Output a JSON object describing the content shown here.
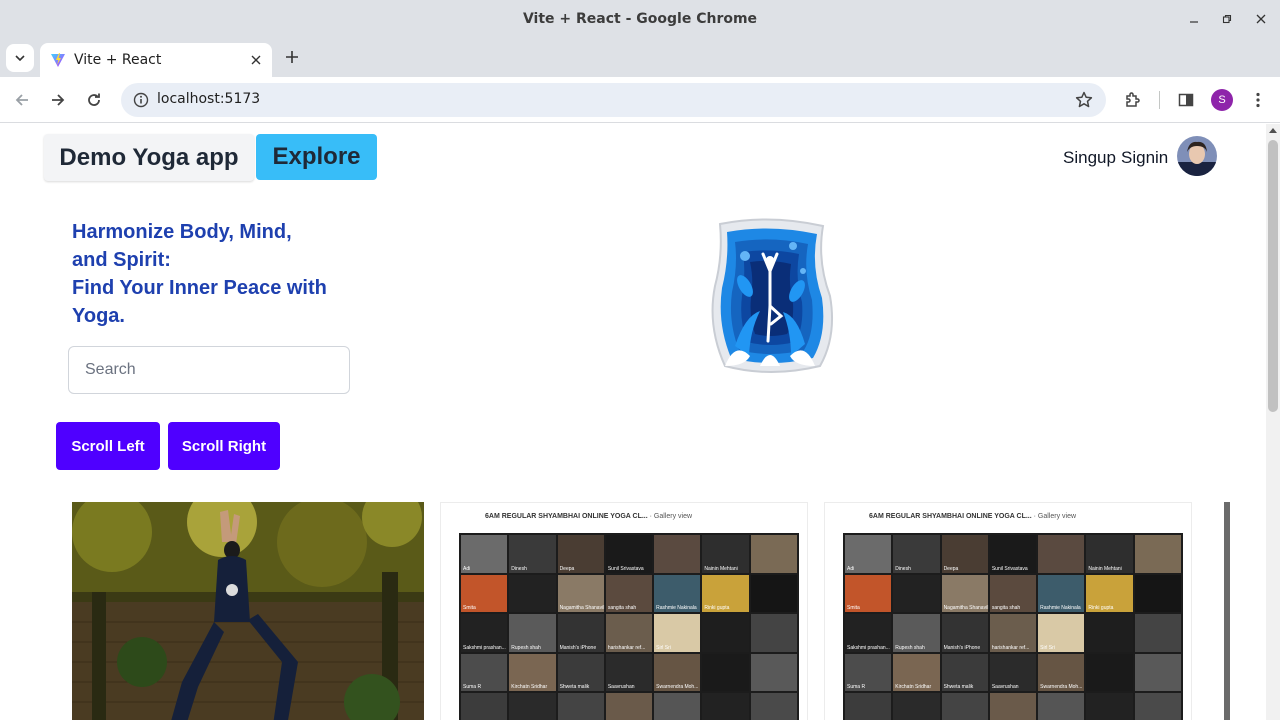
{
  "window": {
    "title": "Vite + React - Google Chrome"
  },
  "tab": {
    "title": "Vite + React"
  },
  "address_bar": {
    "url": "localhost:5173"
  },
  "profile": {
    "initial": "S"
  },
  "nav": {
    "brand": "Demo Yoga app",
    "explore": "Explore",
    "signup": "Singup",
    "signin": "Signin"
  },
  "hero": {
    "headline_line1": "Harmonize Body, Mind,",
    "headline_line2": "and Spirit:",
    "headline_line3": "Find Your Inner Peace with",
    "headline_line4": "Yoga."
  },
  "search": {
    "placeholder": "Search"
  },
  "buttons": {
    "scroll_left": "Scroll Left",
    "scroll_right": "Scroll Right"
  },
  "gallery": {
    "title": "6AM REGULAR SHYAMBHAI ONLINE YOGA CL...",
    "view": "· Gallery view",
    "participants": [
      "Adi",
      "Dinesh",
      "Deepa",
      "Sunil Srivastava",
      "",
      "Nainin Mehtani",
      "",
      "Smita",
      "",
      "Nagamitha Shanavil",
      "sangita shah",
      "Rashmie Nakinala",
      "Rinki gupta",
      "",
      "Sakshmi prashan...",
      "Rupesh shah",
      "Manish's iPhone",
      "harishankar ref...",
      "Sirl Sri",
      "",
      "",
      "Suma R",
      "Kirchatn Sridhar",
      "Shweta malik",
      "Saavrushan",
      "Swarnendra Moh...",
      "",
      "",
      "",
      "",
      "",
      "",
      "",
      "",
      ""
    ],
    "colors": [
      "#6b6b6b",
      "#3a3a3a",
      "#4a3d33",
      "#1a1a1a",
      "#5a4a40",
      "#2e2e2e",
      "#7a6a55",
      "#c2552a",
      "#222",
      "#8a7a66",
      "#5b4a3e",
      "#3d5c6b",
      "#c9a23a",
      "#151515",
      "#222",
      "#5a5a5a",
      "#333",
      "#6b5d4d",
      "#d9c9a6",
      "#1e1e1e",
      "#444",
      "#4c4c4c",
      "#7a6652",
      "#3b3b3b",
      "#2b2b2b",
      "#665544",
      "#1a1a1a",
      "#595959",
      "#3c3c3c",
      "#2a2a2a",
      "#444",
      "#6a5a4a",
      "#555",
      "#222",
      "#4a4a4a"
    ]
  }
}
